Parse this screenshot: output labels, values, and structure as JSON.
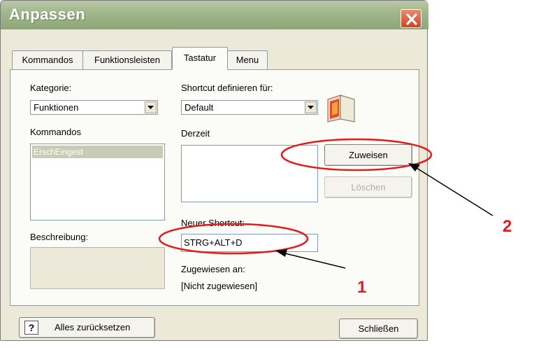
{
  "window": {
    "title": "Anpassen"
  },
  "tabs": [
    {
      "label": "Kommandos",
      "active": false
    },
    {
      "label": "Funktionsleisten",
      "active": false
    },
    {
      "label": "Tastatur",
      "active": true
    },
    {
      "label": "Menu",
      "active": false
    }
  ],
  "kategorie": {
    "label": "Kategorie:",
    "value": "Funktionen"
  },
  "kommandos": {
    "label": "Kommandos",
    "items": [
      "ErschEingest"
    ]
  },
  "beschreibung": {
    "label": "Beschreibung:"
  },
  "shortcut_for": {
    "label": "Shortcut definieren für:",
    "value": "Default"
  },
  "derzeit": {
    "label": "Derzeit"
  },
  "buttons": {
    "assign": "Zuweisen",
    "delete": "Löschen",
    "reset": "Alles zurücksetzen",
    "close": "Schließen",
    "help": "?"
  },
  "new_shortcut": {
    "label": "Neuer Shortcut:",
    "value": "STRG+ALT+D"
  },
  "assigned_to": {
    "label": "Zugewiesen an:",
    "value": "[Nicht zugewiesen]"
  },
  "annotations": {
    "step1": "1",
    "step2": "2"
  },
  "colors": {
    "highlight": "#e21b1b",
    "selection": "#c7cdb5",
    "titlebar": "#9fb58a"
  },
  "icons": {
    "close": "close-icon",
    "dropdown": "chevron-down-icon",
    "book": "book-icon",
    "help": "help-icon"
  }
}
